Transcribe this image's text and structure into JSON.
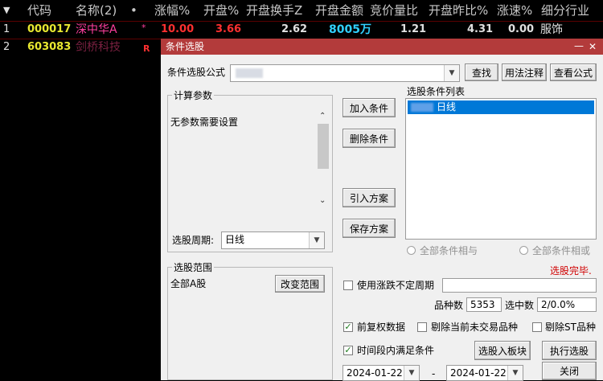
{
  "table": {
    "sort_arrow": "▼",
    "headers": [
      "代码",
      "名称(2)",
      "•",
      "涨幅%",
      "开盘%",
      "开盘换手Z",
      "开盘金额",
      "竞价量比",
      "开盘昨比%",
      "涨速%",
      "细分行业"
    ],
    "rows": [
      {
        "idx": "1",
        "code": "000017",
        "name": "深中华A",
        "flag": "*",
        "chg": "10.00",
        "open": "3.66",
        "turnover": "2.62",
        "amount": "8005万",
        "vol_ratio": "1.21",
        "open_prev": "4.31",
        "speed": "0.00",
        "industry": "服饰"
      },
      {
        "idx": "2",
        "code": "603083",
        "name": "剑桥科技",
        "flag": "R"
      }
    ]
  },
  "dialog": {
    "title": "条件选股",
    "minimize": "—",
    "close": "✕",
    "formula_label": "条件选股公式",
    "btn_find": "查找",
    "btn_usage": "用法注释",
    "btn_view_formula": "查看公式",
    "params_title": "计算参数",
    "params_text": "无参数需要设置",
    "btn_add": "加入条件",
    "btn_delete": "删除条件",
    "btn_import": "引入方案",
    "btn_save": "保存方案",
    "cond_list_title": "选股条件列表",
    "cond_item": "日线",
    "period_label": "选股周期:",
    "period_value": "日线",
    "radio_and": "全部条件相与",
    "radio_or": "全部条件相或",
    "status": "选股完毕.",
    "range_title": "选股范围",
    "range_value": "全部A股",
    "btn_change_range": "改变范围",
    "chk_uncertain_period": "使用涨跌不定周期",
    "count_label": "品种数",
    "count_value": "5353",
    "selected_label": "选中数",
    "selected_value": "2/0.0%",
    "chk_prior_adjust": "前复权数据",
    "chk_prior_adjust_checked": true,
    "chk_remove_untraded": "剔除当前未交易品种",
    "chk_remove_st": "剔除ST品种",
    "chk_time_range": "时间段内满足条件",
    "chk_time_range_checked": true,
    "btn_to_block": "选股入板块",
    "btn_execute": "执行选股",
    "date_from": "2024-01-22",
    "date_sep": "-",
    "date_to": "2024-01-22",
    "btn_close": "关闭"
  },
  "colors": {
    "code_yellow": "#e8e830",
    "name_pink": "#ff3f9f",
    "up_red": "#ff3030",
    "amount_cyan": "#30d0ff",
    "white_num": "#e0e0e0",
    "title_red": "#b33b3b",
    "status_red": "#d00000"
  }
}
